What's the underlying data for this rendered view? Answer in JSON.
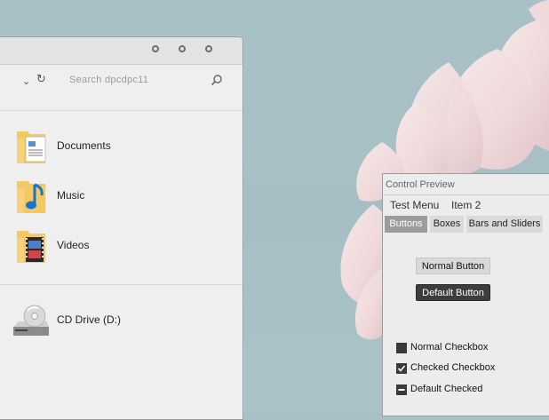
{
  "explorer": {
    "search_placeholder": "Search dpcdpc11",
    "items": [
      {
        "label": "Documents",
        "icon": "documents-folder-icon"
      },
      {
        "label": "Music",
        "icon": "music-folder-icon"
      },
      {
        "label": "Videos",
        "icon": "videos-folder-icon"
      },
      {
        "label": "CD Drive (D:)",
        "icon": "cd-drive-icon"
      }
    ]
  },
  "control_preview": {
    "title": "Control Preview",
    "menu": [
      "Test Menu",
      "Item 2"
    ],
    "tabs": [
      {
        "label": "Buttons",
        "active": true
      },
      {
        "label": "Boxes",
        "active": false
      },
      {
        "label": "Bars and Sliders",
        "active": false
      }
    ],
    "buttons": {
      "normal": "Normal Button",
      "default": "Default Button"
    },
    "checkboxes": [
      {
        "label": "Normal Checkbox",
        "state": "unchecked"
      },
      {
        "label": "Checked Checkbox",
        "state": "checked"
      },
      {
        "label": "Default Checked",
        "state": "indeterminate"
      }
    ]
  },
  "colors": {
    "desktop_bg": "#a9c1c6",
    "petal": "#f3dede",
    "active_tab": "#9c9c9c",
    "default_button": "#3d3d3d"
  }
}
